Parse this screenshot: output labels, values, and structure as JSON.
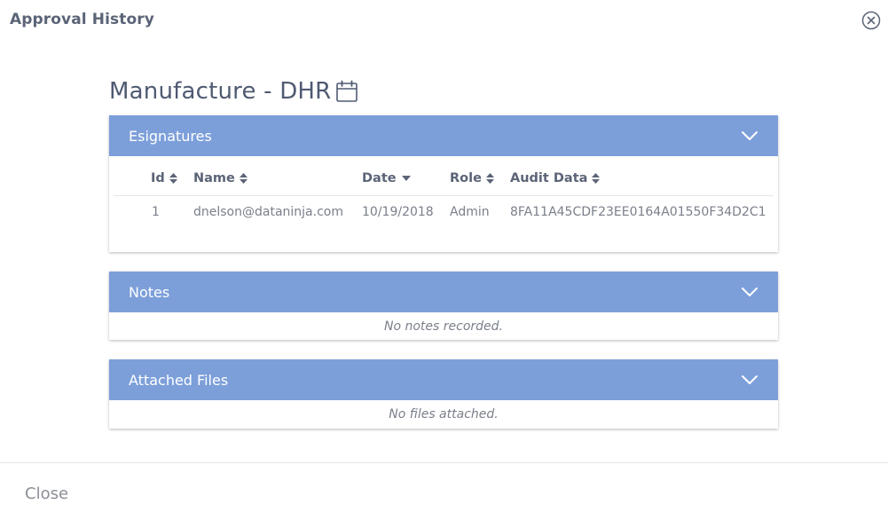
{
  "dialog": {
    "title": "Approval History",
    "close_label": "Close"
  },
  "record": {
    "heading": "Manufacture - DHR"
  },
  "esignatures": {
    "title": "Esignatures",
    "columns": [
      "Id",
      "Name",
      "Date",
      "Role",
      "Audit Data"
    ],
    "rows": [
      [
        "1",
        "dnelson@dataninja.com",
        "10/19/2018",
        "Admin",
        "8FA11A45CDF23EE0164A01550F34D2C1"
      ]
    ]
  },
  "notes": {
    "title": "Notes",
    "empty_text": "No notes recorded."
  },
  "files": {
    "title": "Attached Files",
    "empty_text": "No files attached."
  },
  "colors": {
    "panel_header": "#7c9fda",
    "text": "#4f5a72"
  },
  "icons": {
    "close": "close-circle-icon",
    "calendar": "calendar-icon",
    "chevron": "chevron-down-icon",
    "sort": "sort-icon",
    "sort_desc": "sort-desc-icon"
  }
}
